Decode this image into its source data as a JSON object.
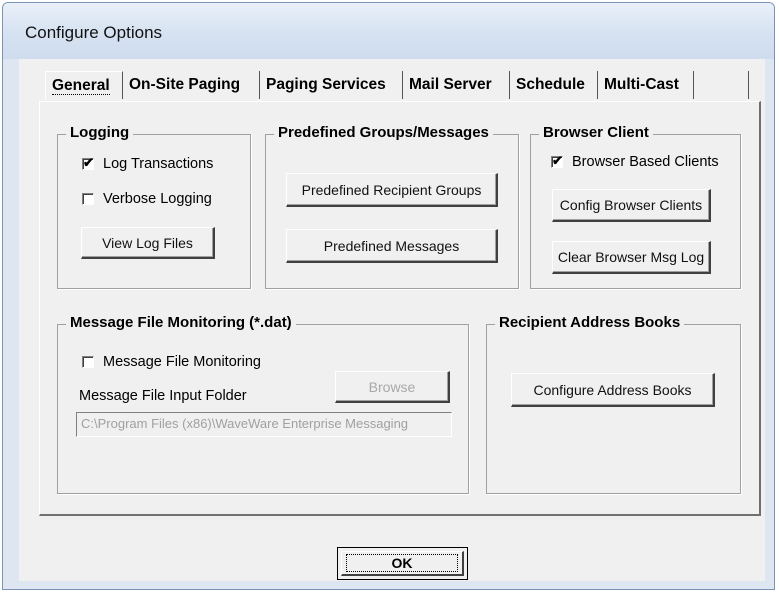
{
  "window": {
    "title": "Configure Options"
  },
  "tabs": [
    {
      "label": "General",
      "active": true
    },
    {
      "label": "On-Site Paging"
    },
    {
      "label": "Paging Services"
    },
    {
      "label": "Mail Server"
    },
    {
      "label": "Schedule"
    },
    {
      "label": "Multi-Cast"
    },
    {
      "label": ""
    }
  ],
  "logging": {
    "title": "Logging",
    "log_transactions": {
      "label": "Log Transactions",
      "checked": true
    },
    "verbose_logging": {
      "label": "Verbose Logging",
      "checked": false
    },
    "view_log_button": "View Log Files"
  },
  "predefined": {
    "title": "Predefined Groups/Messages",
    "groups_button": "Predefined Recipient Groups",
    "messages_button": "Predefined Messages"
  },
  "browser_client": {
    "title": "Browser Client",
    "browser_based": {
      "label": "Browser Based Clients",
      "checked": true
    },
    "config_button": "Config Browser Clients",
    "clear_button": "Clear Browser Msg Log"
  },
  "monitoring": {
    "title": "Message File Monitoring (*.dat)",
    "enabled": {
      "label": "Message File Monitoring",
      "checked": false
    },
    "browse_button": "Browse",
    "folder_label": "Message File Input Folder",
    "folder_value": "C:\\Program Files (x86)\\WaveWare Enterprise Messaging"
  },
  "address_books": {
    "title": "Recipient Address Books",
    "configure_button": "Configure Address Books"
  },
  "footer": {
    "ok_label": "OK"
  },
  "colors": {
    "frame": "#dde6f1",
    "face": "#f0f0f0",
    "border": "#7c94b3"
  }
}
